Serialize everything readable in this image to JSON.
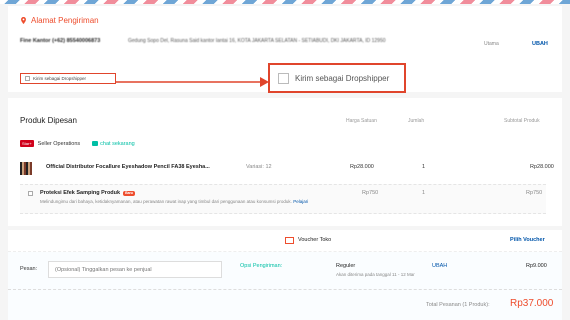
{
  "address": {
    "title": "Alamat Pengiriman",
    "name": "Fine Kantor (+62) 85540006873",
    "detail": "Gedung Sopo Del, Rasuna Said kantor lantai 16, KOTA JAKARTA SELATAN - SETIABUDI, DKI JAKARTA, ID 12950",
    "default_label": "Utama",
    "change_label": "UBAH"
  },
  "dropshipper": {
    "small_label": "Kirim sebagai Dropshipper",
    "big_label": "Kirim sebagai Dropshipper"
  },
  "products": {
    "title": "Produk Dipesan",
    "headers": {
      "unit_price": "Harga Satuan",
      "qty": "Jumlah",
      "subtotal": "Subtotal Produk"
    },
    "shop": {
      "badge": "Star+",
      "name": "Seller Operations",
      "chat": "chat sekarang"
    },
    "item": {
      "name": "Official Distributor Focallure Eyeshadow Pencil FA38 Eyesha...",
      "variant": "Variasi: 12",
      "price": "Rp28.000",
      "qty": "1",
      "subtotal": "Rp28.000"
    },
    "protection": {
      "name": "Proteksi Efek Samping Produk",
      "badge": "Baru",
      "desc": "Melindungimu dari bahaya, ketidaknyamanan, atau perawatan rawat inap yang timbul dari penggunaan atau konsumsi produk.",
      "link": "Pelajari",
      "price": "Rp750",
      "qty": "1",
      "subtotal": "Rp750"
    }
  },
  "voucher": {
    "label": "Voucher Toko",
    "pick": "Pilih Voucher"
  },
  "shipping": {
    "message_label": "Pesan:",
    "message_placeholder": "(Opsional) Tinggalkan pesan ke penjual",
    "option_label": "Opsi Pengiriman:",
    "service": "Reguler",
    "eta": "Akan diterima pada tanggal 11 - 12 Mar",
    "change": "UBAH",
    "price": "Rp9.000"
  },
  "total": {
    "label": "Total Pesanan (1 Produk):",
    "value": "Rp37.000"
  },
  "colors": {
    "accent": "#ee4d2d",
    "link": "#0055aa",
    "teal": "#00bfa5"
  }
}
